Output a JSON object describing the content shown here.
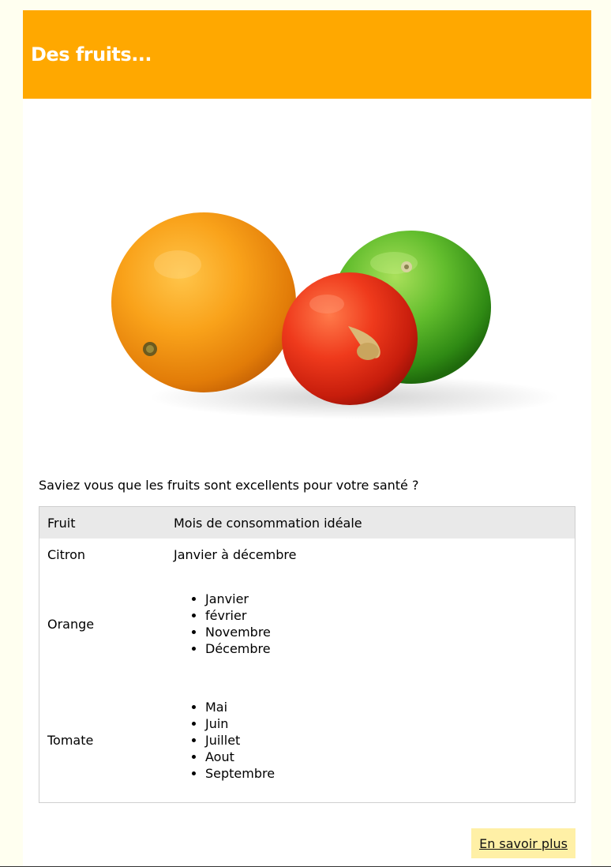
{
  "header": {
    "title": "Des fruits..."
  },
  "hero": {
    "image_name": "fruits-photo",
    "fruits_shown": [
      "orange",
      "citron vert",
      "tomate"
    ]
  },
  "intro": {
    "text": "Saviez vous que les fruits sont excellents pour votre santé ?"
  },
  "table": {
    "headers": [
      "Fruit",
      "Mois de consommation idéale"
    ],
    "rows": [
      {
        "fruit": "Citron",
        "months_text": "Janvier à décembre"
      },
      {
        "fruit": "Orange",
        "months": [
          "Janvier",
          "février",
          "Novembre",
          "Décembre"
        ]
      },
      {
        "fruit": "Tomate",
        "months": [
          "Mai",
          "Juin",
          "Juillet",
          "Aout",
          "Septembre"
        ]
      }
    ]
  },
  "link": {
    "label": "En savoir plus"
  },
  "colors": {
    "header_bg": "#ffa800",
    "page_bg": "#fffff0",
    "table_header_bg": "#e9e9e9",
    "button_bg": "#fff0a6"
  }
}
